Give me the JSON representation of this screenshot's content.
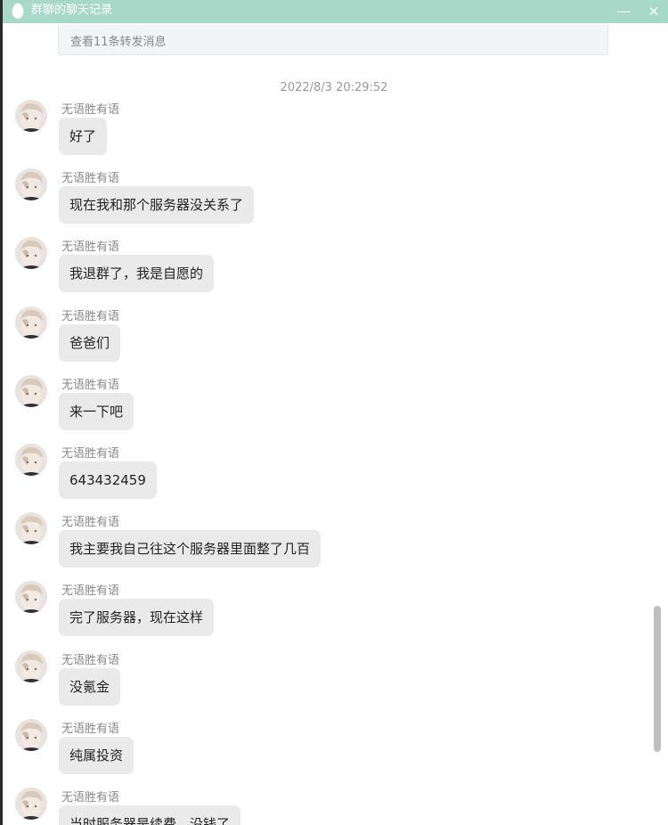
{
  "window": {
    "title": "群聊的聊天记录",
    "minimize_label": "—",
    "close_label": "✕",
    "titlebar_color": "#a8d8c8",
    "app_icon": "penguin-icon"
  },
  "forward": {
    "label": "查看11条转发消息"
  },
  "timestamp": "2022/8/3 20:29:52",
  "messages": [
    {
      "sender": "无语胜有语",
      "text": "好了"
    },
    {
      "sender": "无语胜有语",
      "text": "现在我和那个服务器没关系了"
    },
    {
      "sender": "无语胜有语",
      "text": "我退群了，我是自愿的"
    },
    {
      "sender": "无语胜有语",
      "text": "爸爸们"
    },
    {
      "sender": "无语胜有语",
      "text": "来一下吧"
    },
    {
      "sender": "无语胜有语",
      "text": "643432459"
    },
    {
      "sender": "无语胜有语",
      "text": "我主要我自己往这个服务器里面整了几百"
    },
    {
      "sender": "无语胜有语",
      "text": "完了服务器，现在这样"
    },
    {
      "sender": "无语胜有语",
      "text": "没氪金"
    },
    {
      "sender": "无语胜有语",
      "text": "纯属投资"
    },
    {
      "sender": "无语胜有语",
      "text": "当时服务器是续费，没钱了"
    }
  ]
}
